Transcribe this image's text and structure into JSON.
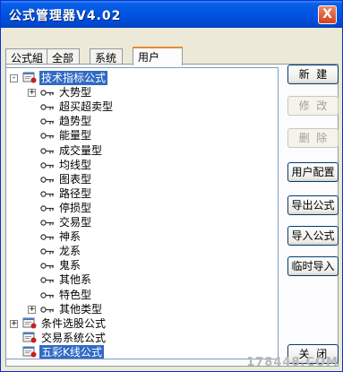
{
  "window": {
    "title": "公式管理器V4.02",
    "close_label": "X"
  },
  "tabs": [
    {
      "label": "公式組",
      "active": false
    },
    {
      "label": "全部",
      "active": false
    },
    {
      "label": "系统",
      "active": false
    },
    {
      "label": "用户",
      "active": true
    }
  ],
  "tree": {
    "nodes": [
      {
        "label": "技术指标公式",
        "level": 0,
        "expander": "-",
        "icon": "folder-icon",
        "selected": true
      },
      {
        "label": "大势型",
        "level": 1,
        "expander": "+",
        "icon": "key-icon",
        "selected": false
      },
      {
        "label": "超买超卖型",
        "level": 1,
        "expander": "",
        "icon": "key-icon",
        "selected": false
      },
      {
        "label": "趋势型",
        "level": 1,
        "expander": "",
        "icon": "key-icon",
        "selected": false
      },
      {
        "label": "能量型",
        "level": 1,
        "expander": "",
        "icon": "key-icon",
        "selected": false
      },
      {
        "label": "成交量型",
        "level": 1,
        "expander": "",
        "icon": "key-icon",
        "selected": false
      },
      {
        "label": "均线型",
        "level": 1,
        "expander": "",
        "icon": "key-icon",
        "selected": false
      },
      {
        "label": "图表型",
        "level": 1,
        "expander": "",
        "icon": "key-icon",
        "selected": false
      },
      {
        "label": "路径型",
        "level": 1,
        "expander": "",
        "icon": "key-icon",
        "selected": false
      },
      {
        "label": "停损型",
        "level": 1,
        "expander": "",
        "icon": "key-icon",
        "selected": false
      },
      {
        "label": "交易型",
        "level": 1,
        "expander": "",
        "icon": "key-icon",
        "selected": false
      },
      {
        "label": "神系",
        "level": 1,
        "expander": "",
        "icon": "key-icon",
        "selected": false
      },
      {
        "label": "龙系",
        "level": 1,
        "expander": "",
        "icon": "key-icon",
        "selected": false
      },
      {
        "label": "鬼系",
        "level": 1,
        "expander": "",
        "icon": "key-icon",
        "selected": false
      },
      {
        "label": "其他系",
        "level": 1,
        "expander": "",
        "icon": "key-icon",
        "selected": false
      },
      {
        "label": "特色型",
        "level": 1,
        "expander": "",
        "icon": "key-icon",
        "selected": false
      },
      {
        "label": "其他类型",
        "level": 1,
        "expander": "+",
        "icon": "key-icon",
        "selected": false
      },
      {
        "label": "条件选股公式",
        "level": 0,
        "expander": "+",
        "icon": "folder-icon",
        "selected": false
      },
      {
        "label": "交易系统公式",
        "level": 0,
        "expander": "",
        "icon": "folder-icon",
        "selected": false
      },
      {
        "label": "五彩K线公式",
        "level": 0,
        "expander": "",
        "icon": "folder-icon",
        "selected": true
      }
    ]
  },
  "buttons": [
    {
      "name": "new-button",
      "label": "新  建",
      "enabled": true
    },
    {
      "name": "modify-button",
      "label": "修  改",
      "enabled": false
    },
    {
      "name": "delete-button",
      "label": "删  除",
      "enabled": false
    },
    {
      "name": "user-config-button",
      "label": "用户配置",
      "enabled": true
    },
    {
      "name": "export-formula-button",
      "label": "导出公式",
      "enabled": true
    },
    {
      "name": "import-formula-button",
      "label": "导入公式",
      "enabled": true
    },
    {
      "name": "temp-import-button",
      "label": "临时导入",
      "enabled": true
    },
    {
      "name": "close-button",
      "label": "关  闭",
      "enabled": true
    }
  ],
  "watermark": "178448.COM",
  "colors": {
    "titlebar": "#0054e3",
    "selection": "#316ac5",
    "folder_red": "#c0241c"
  }
}
